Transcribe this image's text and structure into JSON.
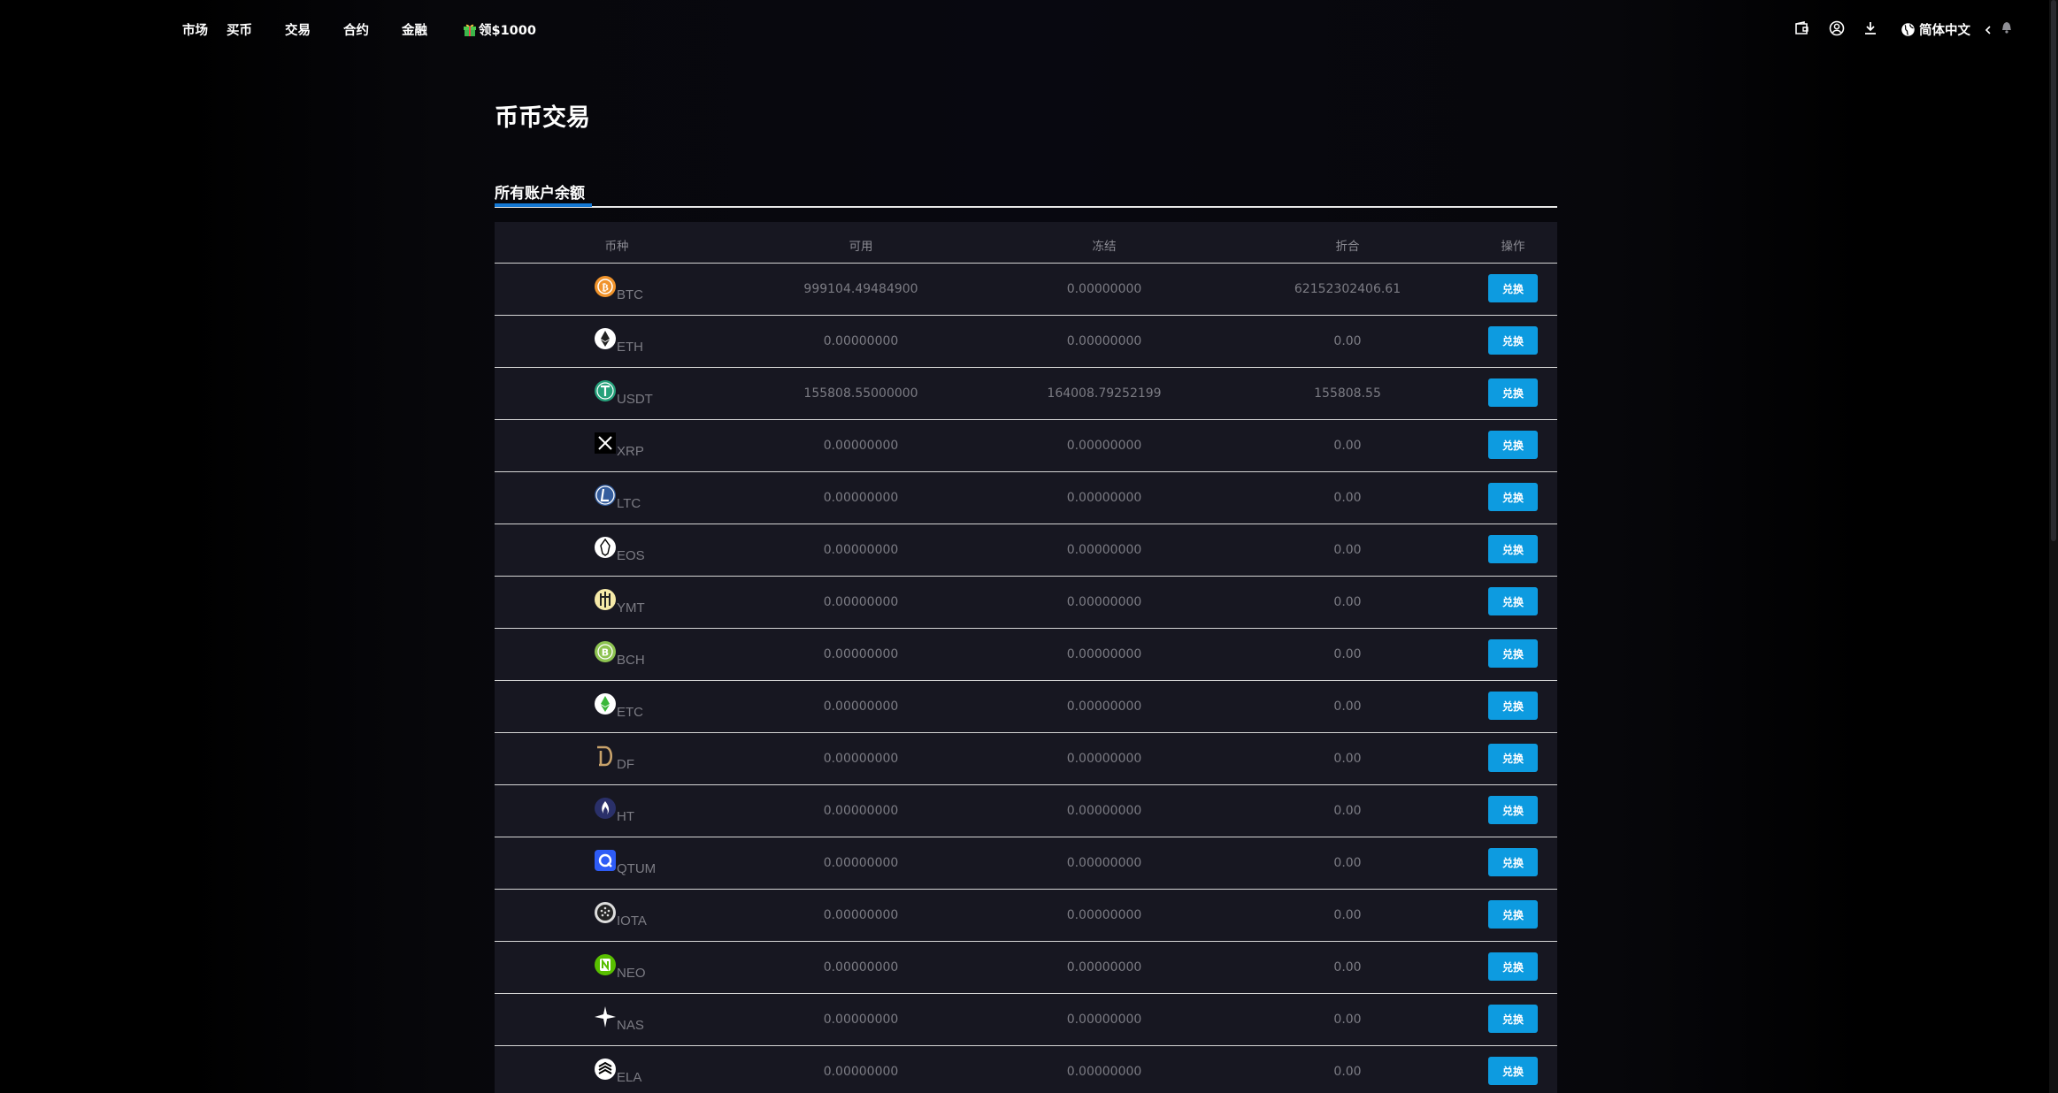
{
  "nav": {
    "items": [
      "市场",
      "买币",
      "交易",
      "合约",
      "金融"
    ],
    "promo": "领$1000",
    "lang": "简体中文"
  },
  "page": {
    "title": "币币交易",
    "section_tab": "所有账户余额"
  },
  "table": {
    "headers": {
      "coin": "币种",
      "available": "可用",
      "frozen": "冻结",
      "converted": "折合",
      "action": "操作"
    },
    "action_label": "兑换",
    "rows": [
      {
        "coin": "BTC",
        "icon": "btc-icon",
        "color": "#f0932b",
        "available": "999104.49484900",
        "frozen": "0.00000000",
        "converted": "62152302406.61"
      },
      {
        "coin": "ETH",
        "icon": "eth-icon",
        "color": "#ffffff",
        "available": "0.00000000",
        "frozen": "0.00000000",
        "converted": "0.00"
      },
      {
        "coin": "USDT",
        "icon": "usdt-icon",
        "color": "#26a17b",
        "available": "155808.55000000",
        "frozen": "164008.79252199",
        "converted": "155808.55"
      },
      {
        "coin": "XRP",
        "icon": "xrp-icon",
        "color": "#000000",
        "available": "0.00000000",
        "frozen": "0.00000000",
        "converted": "0.00"
      },
      {
        "coin": "LTC",
        "icon": "ltc-icon",
        "color": "#345d9d",
        "available": "0.00000000",
        "frozen": "0.00000000",
        "converted": "0.00"
      },
      {
        "coin": "EOS",
        "icon": "eos-icon",
        "color": "#ffffff",
        "available": "0.00000000",
        "frozen": "0.00000000",
        "converted": "0.00"
      },
      {
        "coin": "YMT",
        "icon": "ymt-icon",
        "color": "#f5e9a8",
        "available": "0.00000000",
        "frozen": "0.00000000",
        "converted": "0.00"
      },
      {
        "coin": "BCH",
        "icon": "bch-icon",
        "color": "#8dc351",
        "available": "0.00000000",
        "frozen": "0.00000000",
        "converted": "0.00"
      },
      {
        "coin": "ETC",
        "icon": "etc-icon",
        "color": "#ffffff",
        "available": "0.00000000",
        "frozen": "0.00000000",
        "converted": "0.00"
      },
      {
        "coin": "DF",
        "icon": "df-icon",
        "color": "#c8a26a",
        "available": "0.00000000",
        "frozen": "0.00000000",
        "converted": "0.00"
      },
      {
        "coin": "HT",
        "icon": "ht-icon",
        "color": "#2a3069",
        "available": "0.00000000",
        "frozen": "0.00000000",
        "converted": "0.00"
      },
      {
        "coin": "QTUM",
        "icon": "qtum-icon",
        "color": "#2e5cf6",
        "available": "0.00000000",
        "frozen": "0.00000000",
        "converted": "0.00"
      },
      {
        "coin": "IOTA",
        "icon": "iota-icon",
        "color": "#242424",
        "available": "0.00000000",
        "frozen": "0.00000000",
        "converted": "0.00"
      },
      {
        "coin": "NEO",
        "icon": "neo-icon",
        "color": "#58bf00",
        "available": "0.00000000",
        "frozen": "0.00000000",
        "converted": "0.00"
      },
      {
        "coin": "NAS",
        "icon": "nas-icon",
        "color": "#ffffff",
        "available": "0.00000000",
        "frozen": "0.00000000",
        "converted": "0.00"
      },
      {
        "coin": "ELA",
        "icon": "ela-icon",
        "color": "#ffffff",
        "available": "0.00000000",
        "frozen": "0.00000000",
        "converted": "0.00"
      }
    ]
  }
}
